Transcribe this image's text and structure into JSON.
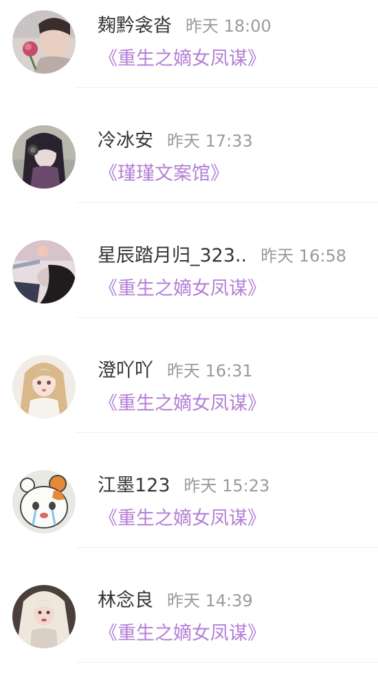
{
  "comments": [
    {
      "name": "麹黔衾沓",
      "time": "昨天 18:00",
      "book": "《重生之嫡女凤谋》",
      "avatar_icon": "avatar-man-with-rose-icon"
    },
    {
      "name": "冷冰安",
      "time": "昨天 17:33",
      "book": "《瑾瑾文案馆》",
      "avatar_icon": "avatar-anime-girl-headphones-icon"
    },
    {
      "name": "星辰踏月归_323..",
      "time": "昨天 16:58",
      "book": "《重生之嫡女凤谋》",
      "avatar_icon": "avatar-lying-person-icon"
    },
    {
      "name": "澄吖吖",
      "time": "昨天 16:31",
      "book": "《重生之嫡女凤谋》",
      "avatar_icon": "avatar-blonde-anime-girl-icon"
    },
    {
      "name": "江墨123",
      "time": "昨天 15:23",
      "book": "《重生之嫡女凤谋》",
      "avatar_icon": "avatar-crying-bear-icon"
    },
    {
      "name": "林念良",
      "time": "昨天 14:39",
      "book": "《重生之嫡女凤谋》",
      "avatar_icon": "avatar-blonde-woman-icon"
    }
  ],
  "colors": {
    "name": "#333333",
    "time": "#9a9a9a",
    "book_link": "#b47fd6",
    "divider": "#eeeeee",
    "background": "#ffffff"
  }
}
